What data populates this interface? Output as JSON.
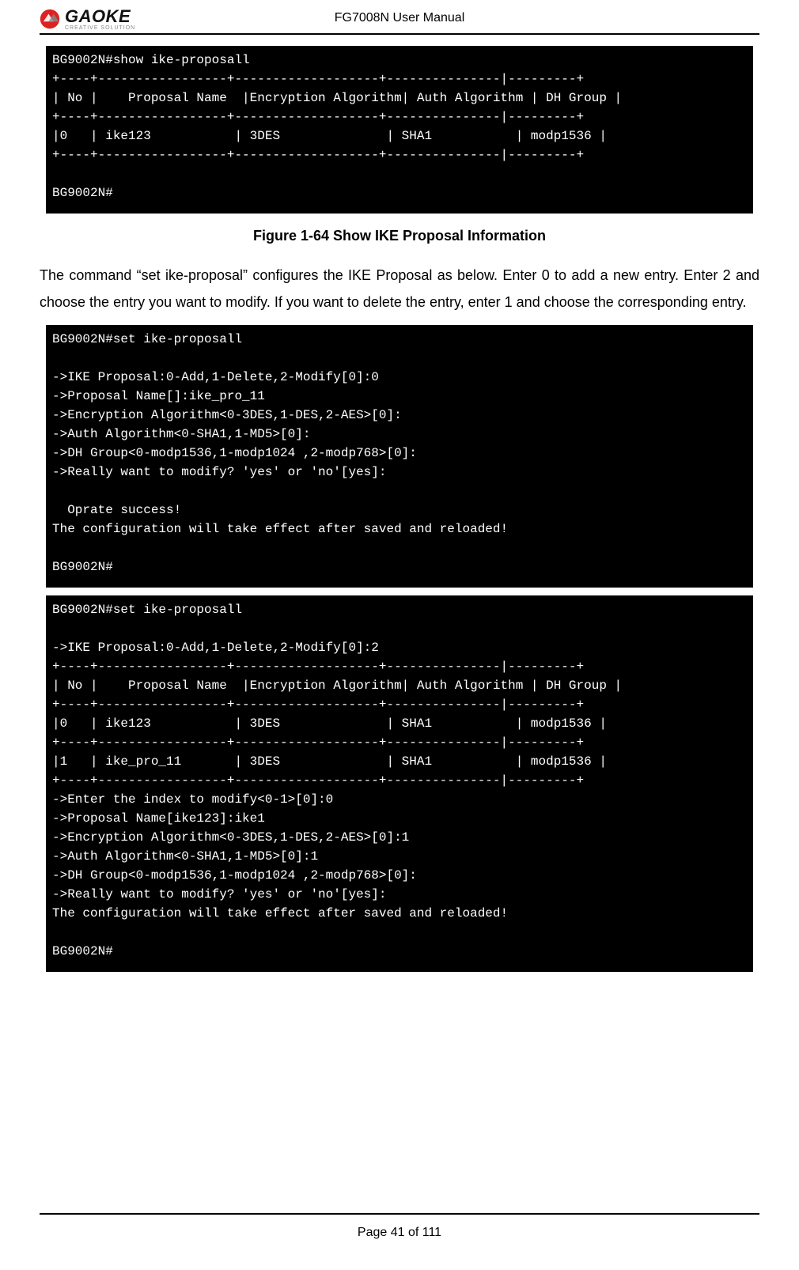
{
  "header": {
    "title": "FG7008N User Manual",
    "logo": {
      "brand": "GAOKE",
      "tagline": "CREATIVE SOLUTION"
    }
  },
  "figure1": {
    "caption": "Figure 1-64    Show IKE Proposal Information",
    "terminal": {
      "cmd": "BG9002N#show ike-proposall",
      "sep1": "+----+-----------------+-------------------+---------------|---------+",
      "hdr": "| No |    Proposal Name  |Encryption Algorithm| Auth Algorithm | DH Group |",
      "sep2": "+----+-----------------+-------------------+---------------|---------+",
      "row": "|0   | ike123           | 3DES              | SHA1           | modp1536 |",
      "sep3": "+----+-----------------+-------------------+---------------|---------+",
      "blank": "",
      "prompt": "BG9002N#"
    }
  },
  "para1": "The command “set ike-proposal” configures the IKE Proposal as below. Enter 0 to add a new entry. Enter 2 and choose the entry you want to modify. If you want to delete the entry, enter 1 and choose the corresponding entry.",
  "figure2": {
    "terminal": {
      "l1": "BG9002N#set ike-proposall",
      "l2": "",
      "l3": "->IKE Proposal:0-Add,1-Delete,2-Modify[0]:0",
      "l4": "->Proposal Name[]:ike_pro_11",
      "l5": "->Encryption Algorithm<0-3DES,1-DES,2-AES>[0]:",
      "l6": "->Auth Algorithm<0-SHA1,1-MD5>[0]:",
      "l7": "->DH Group<0-modp1536,1-modp1024 ,2-modp768>[0]:",
      "l8": "->Really want to modify? 'yes' or 'no'[yes]:",
      "l9": "",
      "l10": "  Oprate success!",
      "l11": "The configuration will take effect after saved and reloaded!",
      "l12": "",
      "l13": "BG9002N#"
    }
  },
  "figure3": {
    "terminal": {
      "l1": "BG9002N#set ike-proposall",
      "l2": "",
      "l3": "->IKE Proposal:0-Add,1-Delete,2-Modify[0]:2",
      "sep1": "+----+-----------------+-------------------+---------------|---------+",
      "hdr": "| No |    Proposal Name  |Encryption Algorithm| Auth Algorithm | DH Group |",
      "sep2": "+----+-----------------+-------------------+---------------|---------+",
      "r1": "|0   | ike123           | 3DES              | SHA1           | modp1536 |",
      "sep3": "+----+-----------------+-------------------+---------------|---------+",
      "r2": "|1   | ike_pro_11       | 3DES              | SHA1           | modp1536 |",
      "sep4": "+----+-----------------+-------------------+---------------|---------+",
      "l4": "->Enter the index to modify<0-1>[0]:0",
      "l5": "->Proposal Name[ike123]:ike1",
      "l6": "->Encryption Algorithm<0-3DES,1-DES,2-AES>[0]:1",
      "l7": "->Auth Algorithm<0-SHA1,1-MD5>[0]:1",
      "l8": "->DH Group<0-modp1536,1-modp1024 ,2-modp768>[0]:",
      "l9": "->Really want to modify? 'yes' or 'no'[yes]:",
      "l10": "The configuration will take effect after saved and reloaded!",
      "l11": "",
      "l12": "BG9002N#"
    }
  },
  "footer": {
    "page": "Page 41 of 111"
  }
}
